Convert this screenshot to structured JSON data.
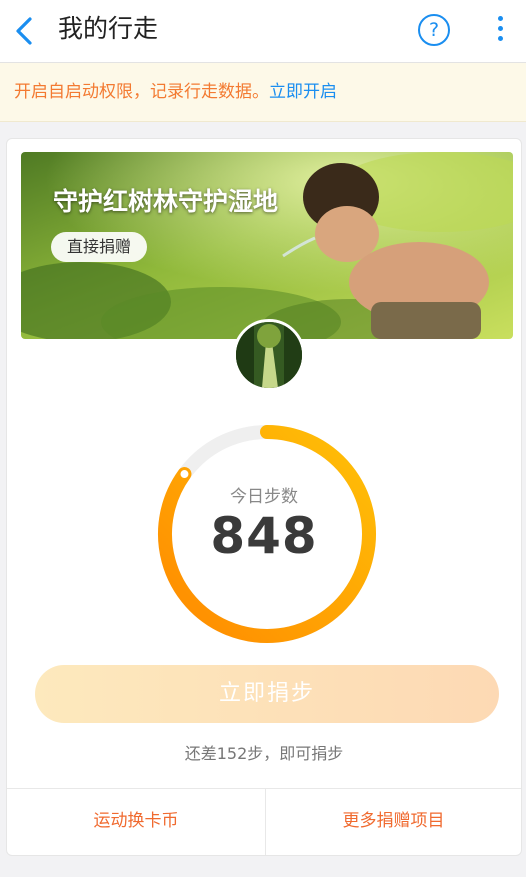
{
  "header": {
    "title": "我的行走",
    "help_icon_glyph": "?",
    "icons": [
      "back-arrow-icon",
      "help-icon",
      "more-vertical-icon"
    ]
  },
  "notice": {
    "text": "开启自启动权限，记录行走数据。",
    "link": "立即开启"
  },
  "banner": {
    "title": "守护红树林守护湿地",
    "button": "直接捐赠"
  },
  "steps": {
    "label": "今日步数",
    "value": "848",
    "progress_fraction": 0.85
  },
  "donate_steps_button": "立即捐步",
  "hint": "还差152步，即可捐步",
  "bottom_actions": {
    "left": "运动换卡币",
    "right": "更多捐赠项目"
  },
  "colors": {
    "accent_blue": "#1a8ef0",
    "accent_orange": "#f37a31",
    "ring_start": "#ff8a00",
    "ring_end": "#ffc107",
    "ring_track": "#efefef"
  }
}
